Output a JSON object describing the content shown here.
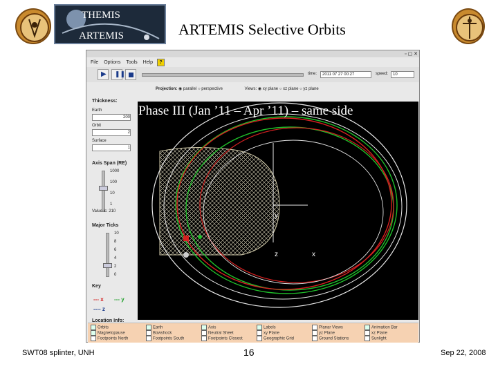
{
  "header": {
    "banner_line1": "THEMIS",
    "banner_line2": "ARTEMIS",
    "title": "ARTEMIS Selective Orbits"
  },
  "app": {
    "menu": [
      "File",
      "Options",
      "Tools",
      "Help"
    ],
    "time_label": "time:",
    "time_value": "2011 07 27 00:27",
    "speed_label": "speed:",
    "speed_value": "10",
    "projection_label": "Projection:",
    "projection_options": [
      "parallel",
      "perspective"
    ],
    "views_label": "Views:",
    "views_options": [
      "xy plane",
      "xz plane",
      "yz plane"
    ],
    "thickness": {
      "label": "Thickness:",
      "fields": [
        {
          "name": "Earth",
          "value": "200"
        },
        {
          "name": "Orbit",
          "value": "2"
        },
        {
          "name": "Surface",
          "value": "1"
        }
      ]
    },
    "axis_span": {
      "label": "Axis Span (RE)",
      "ticks": [
        "1000",
        "100",
        "10",
        "1"
      ],
      "value_text": "Value is: 210"
    },
    "major_ticks": {
      "label": "Major Ticks",
      "ticks": [
        "10",
        "8",
        "6",
        "4",
        "2",
        "0"
      ]
    },
    "key": {
      "label": "Key",
      "x": "--- x",
      "y": "--- y",
      "z": "---- z"
    },
    "location_info_label": "Location Info:",
    "checkboxes": [
      [
        "Orbits",
        "Magnetopause",
        "Footpoints North"
      ],
      [
        "Earth",
        "Bowshock",
        "Footpoints South"
      ],
      [
        "Axis",
        "Neutral Sheet",
        "Footpoints Closest"
      ],
      [
        "Labels",
        "xy Plane",
        "Geographic Grid"
      ],
      [
        "Planar Views",
        "yz Plane",
        "Ground Stations"
      ],
      [
        "Animation Bar",
        "xz Plane",
        "Sunlight"
      ]
    ],
    "axis_labels": {
      "y": "y",
      "x": "x",
      "z": "z"
    }
  },
  "overlay_title": "Phase III (Jan ’11 – Apr ’11) – same side",
  "footer": {
    "left": "SWT08 splinter, UNH",
    "page": "16",
    "date": "Sep 22, 2008"
  },
  "colors": {
    "green_orbit": "#1fbf2a",
    "red_orbit": "#d42020",
    "white_orbit": "#e8e8e8",
    "magnetosphere_mesh": "#d9d3b8"
  }
}
